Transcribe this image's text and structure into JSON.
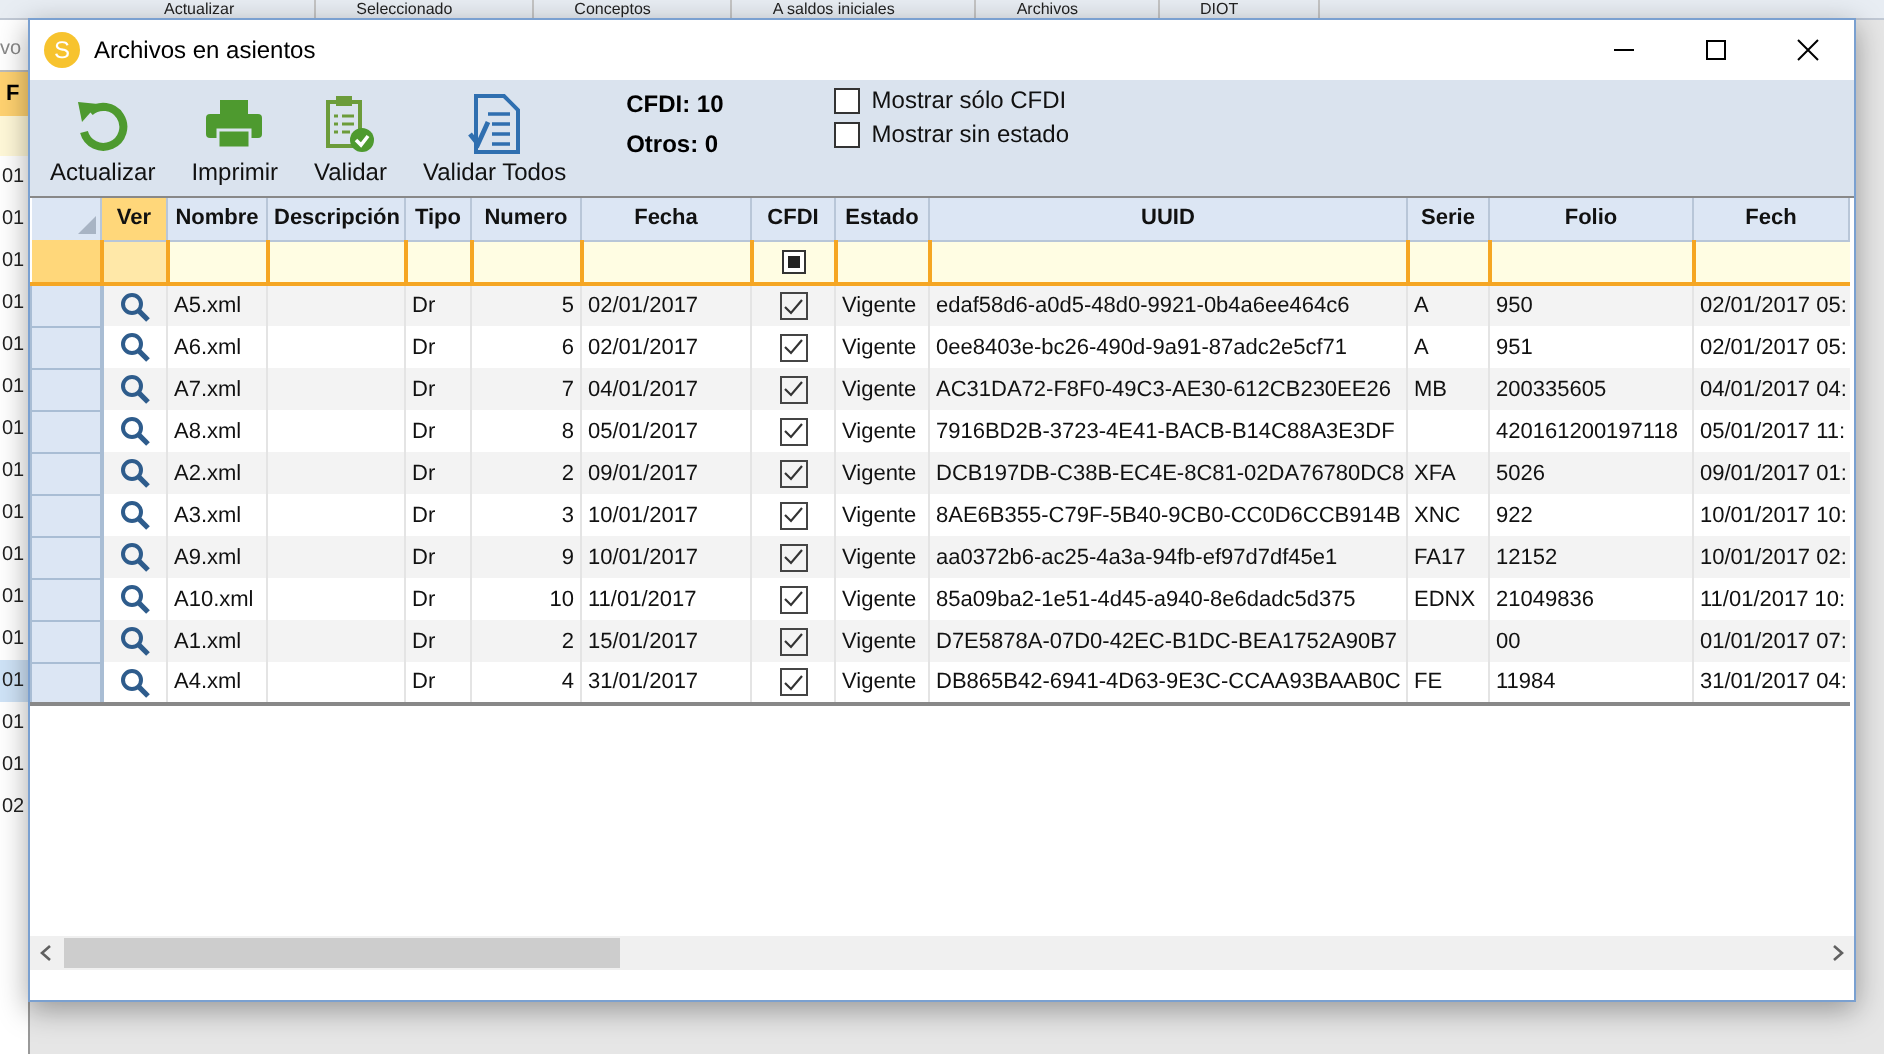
{
  "background_app": {
    "toolbar": [
      "Actualizar",
      "Seleccionado",
      "Conceptos",
      "A saldos iniciales",
      "Archivos",
      "DIOT"
    ],
    "breadcrumb": "vo",
    "column_header": "F",
    "date_cells": [
      "01",
      "01",
      "01",
      "01",
      "01",
      "01",
      "01",
      "01",
      "01",
      "01",
      "01",
      "01",
      "01",
      "01",
      "01",
      "02"
    ]
  },
  "window": {
    "title": "Archivos en asientos",
    "icon_letter": "S"
  },
  "toolbar": {
    "buttons": [
      {
        "kind": "refresh",
        "label": "Actualizar"
      },
      {
        "kind": "print",
        "label": "Imprimir"
      },
      {
        "kind": "validate",
        "label": "Validar"
      },
      {
        "kind": "validate_all",
        "label": "Validar Todos"
      }
    ],
    "counts": [
      "CFDI: 10",
      "Otros: 0"
    ],
    "options": [
      {
        "label": "Mostrar sólo CFDI",
        "checked": false
      },
      {
        "label": "Mostrar sin estado",
        "checked": false
      }
    ]
  },
  "grid": {
    "columns": [
      {
        "label": "Ver",
        "kind": "icon",
        "highlighted": true
      },
      {
        "label": "Nombre",
        "kind": "text",
        "highlighted": false
      },
      {
        "label": "Descripción",
        "kind": "text",
        "highlighted": false
      },
      {
        "label": "Tipo",
        "kind": "text",
        "highlighted": false
      },
      {
        "label": "Numero",
        "kind": "number",
        "highlighted": false
      },
      {
        "label": "Fecha",
        "kind": "text",
        "highlighted": false
      },
      {
        "label": "CFDI",
        "kind": "check",
        "highlighted": false
      },
      {
        "label": "Estado",
        "kind": "text",
        "highlighted": false
      },
      {
        "label": "UUID",
        "kind": "text",
        "highlighted": false
      },
      {
        "label": "Serie",
        "kind": "text",
        "highlighted": false
      },
      {
        "label": "Folio",
        "kind": "text",
        "highlighted": false
      },
      {
        "label": "Fech",
        "kind": "text",
        "highlighted": false
      }
    ],
    "filter_row": {
      "cfdi_indeterminate": true
    },
    "rows": [
      {
        "nombre": "A5.xml",
        "tipo": "Dr",
        "numero": "5",
        "fecha": "02/01/2017",
        "cfdi": true,
        "estado": "Vigente",
        "uuid": "edaf58d6-a0d5-48d0-9921-0b4a6ee464c6",
        "serie": "A",
        "folio": "950",
        "fecha_hora": "02/01/2017 05:"
      },
      {
        "nombre": "A6.xml",
        "tipo": "Dr",
        "numero": "6",
        "fecha": "02/01/2017",
        "cfdi": true,
        "estado": "Vigente",
        "uuid": "0ee8403e-bc26-490d-9a91-87adc2e5cf71",
        "serie": "A",
        "folio": "951",
        "fecha_hora": "02/01/2017 05:"
      },
      {
        "nombre": "A7.xml",
        "tipo": "Dr",
        "numero": "7",
        "fecha": "04/01/2017",
        "cfdi": true,
        "estado": "Vigente",
        "uuid": "AC31DA72-F8F0-49C3-AE30-612CB230EE26",
        "serie": "MB",
        "folio": "200335605",
        "fecha_hora": "04/01/2017 04:"
      },
      {
        "nombre": "A8.xml",
        "tipo": "Dr",
        "numero": "8",
        "fecha": "05/01/2017",
        "cfdi": true,
        "estado": "Vigente",
        "uuid": "7916BD2B-3723-4E41-BACB-B14C88A3E3DF",
        "folio": "420161200197118",
        "fecha_hora": "05/01/2017 11:"
      },
      {
        "nombre": "A2.xml",
        "tipo": "Dr",
        "numero": "2",
        "fecha": "09/01/2017",
        "cfdi": true,
        "estado": "Vigente",
        "uuid": "DCB197DB-C38B-EC4E-8C81-02DA76780DC8",
        "serie": "XFA",
        "folio": "5026",
        "fecha_hora": "09/01/2017 01:"
      },
      {
        "nombre": "A3.xml",
        "tipo": "Dr",
        "numero": "3",
        "fecha": "10/01/2017",
        "cfdi": true,
        "estado": "Vigente",
        "uuid": "8AE6B355-C79F-5B40-9CB0-CC0D6CCB914B",
        "serie": "XNC",
        "folio": "922",
        "fecha_hora": "10/01/2017 10:"
      },
      {
        "nombre": "A9.xml",
        "tipo": "Dr",
        "numero": "9",
        "fecha": "10/01/2017",
        "cfdi": true,
        "estado": "Vigente",
        "uuid": "aa0372b6-ac25-4a3a-94fb-ef97d7df45e1",
        "serie": "FA17",
        "folio": "12152",
        "fecha_hora": "10/01/2017 02:"
      },
      {
        "nombre": "A10.xml",
        "tipo": "Dr",
        "numero": "10",
        "fecha": "11/01/2017",
        "cfdi": true,
        "estado": "Vigente",
        "uuid": "85a09ba2-1e51-4d45-a940-8e6dadc5d375",
        "serie": "EDNX",
        "folio": "21049836",
        "fecha_hora": "11/01/2017 10:"
      },
      {
        "nombre": "A1.xml",
        "tipo": "Dr",
        "numero": "2",
        "fecha": "15/01/2017",
        "cfdi": true,
        "estado": "Vigente",
        "uuid": "D7E5878A-07D0-42EC-B1DC-BEA1752A90B7",
        "folio": "00",
        "fecha_hora": "01/01/2017 07:"
      },
      {
        "nombre": "A4.xml",
        "tipo": "Dr",
        "numero": "4",
        "fecha": "31/01/2017",
        "cfdi": true,
        "estado": "Vigente",
        "uuid": "DB865B42-6941-4D63-9E3C-CCAA93BAAB0C",
        "serie": "FE",
        "folio": "11984",
        "fecha_hora": "31/01/2017 04:"
      }
    ]
  }
}
